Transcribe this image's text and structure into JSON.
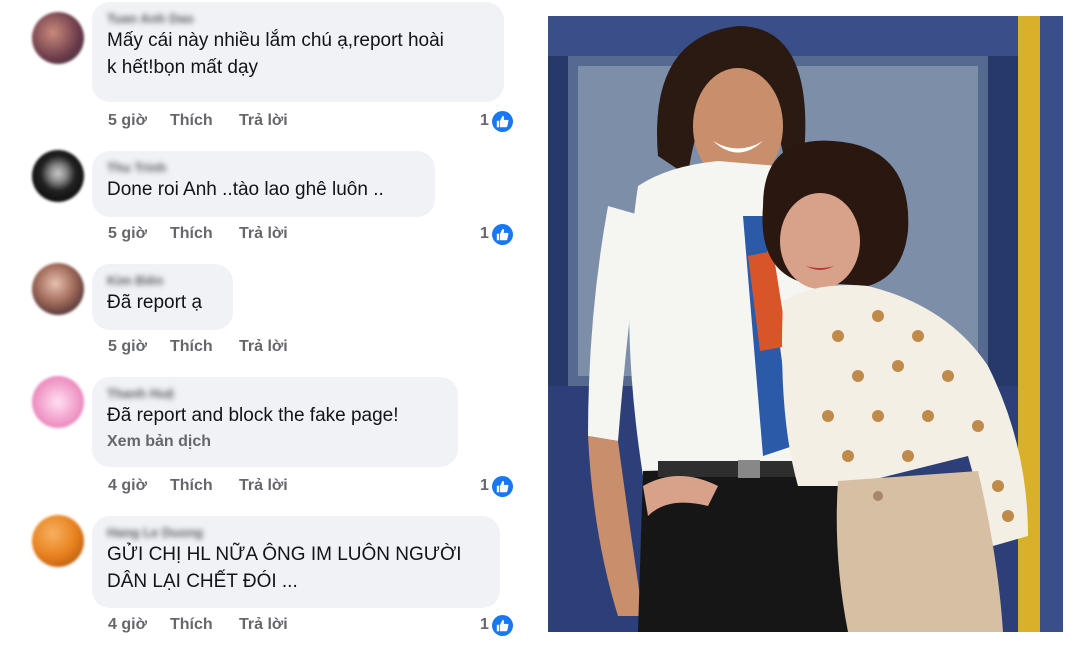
{
  "comments": [
    {
      "author": "Tuan Anh Dao",
      "text": "Mấy cái này nhiều lắm chú ạ,report hoài\nk hết!bọn mất dạy",
      "time": "5 giờ",
      "like_label": "Thích",
      "reply_label": "Trả lời",
      "reactions": "1",
      "avatar_color": "#7a4a5a"
    },
    {
      "author": "Thu Trinh",
      "text": "Done roi Anh ..tào lao ghê luôn ..",
      "time": "5 giờ",
      "like_label": "Thích",
      "reply_label": "Trả lời",
      "reactions": "1",
      "avatar_color": "#2a2a2a"
    },
    {
      "author": "Kim Biên",
      "text": "Đã report ạ",
      "time": "5 giờ",
      "like_label": "Thích",
      "reply_label": "Trả lời",
      "reactions": "",
      "avatar_color": "#8a5a4a"
    },
    {
      "author": "Thanh Huệ",
      "text": "Đã report and block the fake page!",
      "translate": "Xem bản dịch",
      "time": "4 giờ",
      "like_label": "Thích",
      "reply_label": "Trả lời",
      "reactions": "1",
      "avatar_color": "#f3a9cf"
    },
    {
      "author": "Hang Le Duong",
      "text": "GỬI CHỊ HL NỮA ÔNG IM LUÔN NGƯỜI\nDÂN LẠI CHẾT ĐÓI ...",
      "time": "4 giờ",
      "like_label": "Thích",
      "reply_label": "Trả lời",
      "reactions": "1",
      "avatar_color": "#e8821e"
    }
  ],
  "colors": {
    "bubble": "#f0f2f5",
    "like_blue": "#1877f2",
    "meta_gray": "#65676b"
  }
}
